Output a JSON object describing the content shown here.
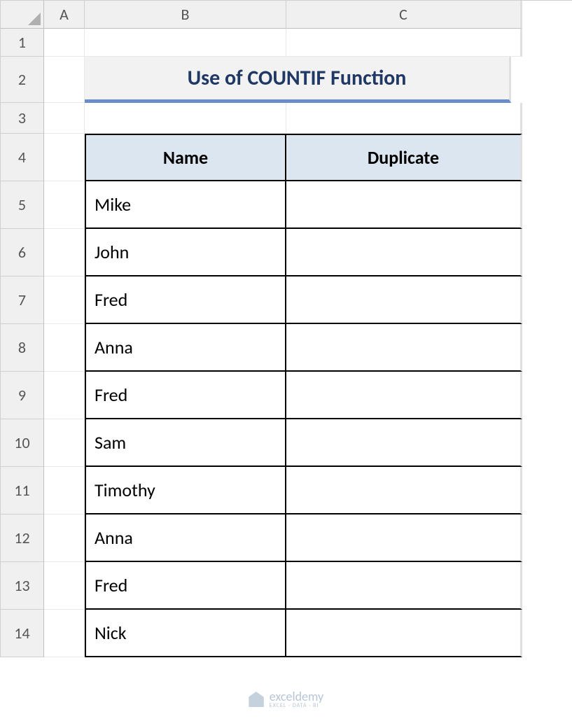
{
  "columns": [
    "A",
    "B",
    "C"
  ],
  "rows": [
    "1",
    "2",
    "3",
    "4",
    "5",
    "6",
    "7",
    "8",
    "9",
    "10",
    "11",
    "12",
    "13",
    "14"
  ],
  "title": "Use of COUNTIF Function",
  "headers": {
    "name": "Name",
    "duplicate": "Duplicate"
  },
  "data": [
    {
      "name": "Mike",
      "duplicate": ""
    },
    {
      "name": "John",
      "duplicate": ""
    },
    {
      "name": "Fred",
      "duplicate": ""
    },
    {
      "name": "Anna",
      "duplicate": ""
    },
    {
      "name": "Fred",
      "duplicate": ""
    },
    {
      "name": "Sam",
      "duplicate": ""
    },
    {
      "name": "Timothy",
      "duplicate": ""
    },
    {
      "name": "Anna",
      "duplicate": ""
    },
    {
      "name": "Fred",
      "duplicate": ""
    },
    {
      "name": "Nick",
      "duplicate": ""
    }
  ],
  "watermark": {
    "brand": "exceldemy",
    "tagline": "EXCEL · DATA · BI"
  }
}
